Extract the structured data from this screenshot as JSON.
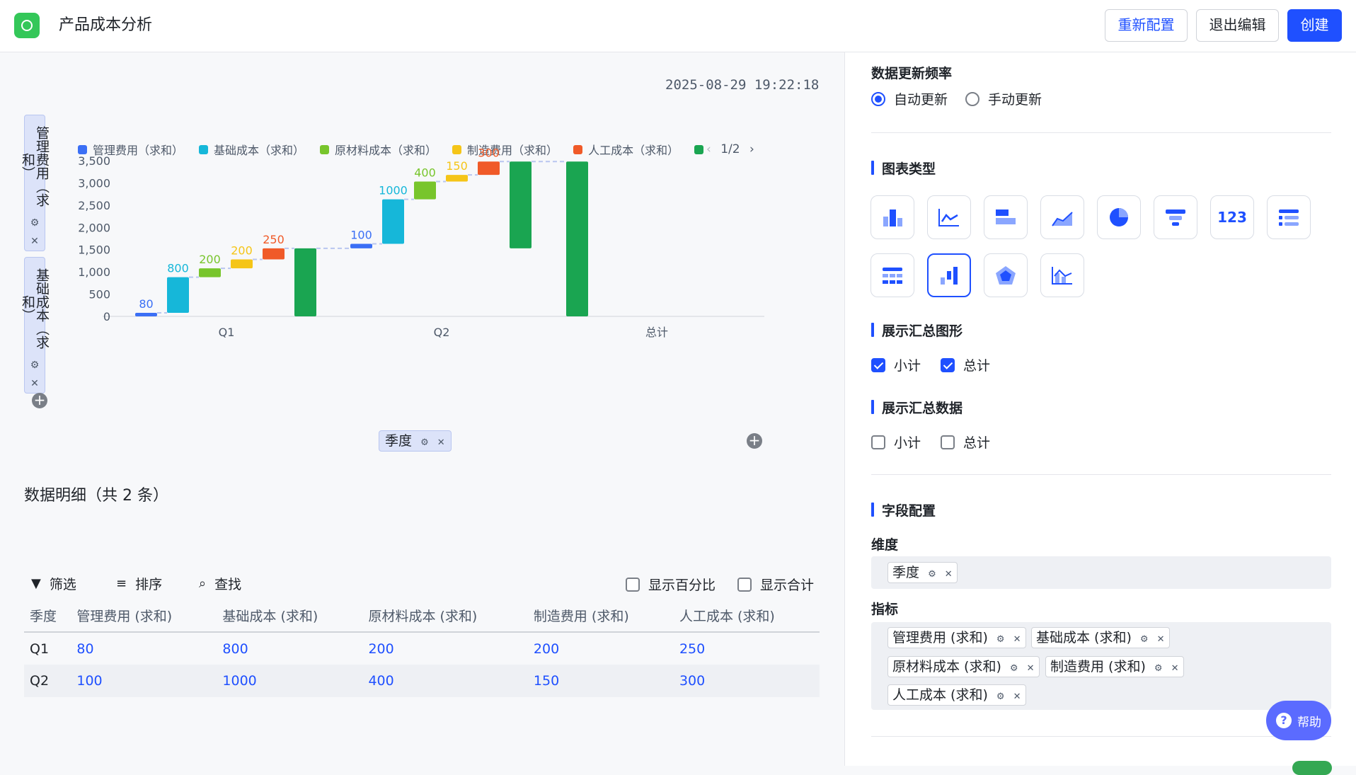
{
  "header": {
    "title": "产品成本分析",
    "reconfigure_label": "重新配置",
    "exit_label": "退出编辑",
    "create_label": "创建"
  },
  "timestamp": "2025-08-29 19:22:18",
  "axis_tags": {
    "measure1": "管理费用（求和）",
    "measure2": "基础成本（求和）"
  },
  "legend": {
    "items": [
      {
        "label": "管理费用（求和）",
        "color": "#3b6ff5"
      },
      {
        "label": "基础成本（求和）",
        "color": "#16b7d9"
      },
      {
        "label": "原材料成本（求和）",
        "color": "#78c52c"
      },
      {
        "label": "制造费用（求和）",
        "color": "#f5c518"
      },
      {
        "label": "人工成本（求和）",
        "color": "#f05a28"
      },
      {
        "label": "",
        "color": "#1aa551"
      }
    ],
    "page": "1/2"
  },
  "chart_data": {
    "type": "bar",
    "subtype": "waterfall",
    "categories": [
      "Q1",
      "Q2",
      "总计"
    ],
    "yticks": [
      "0",
      "500",
      "1,000",
      "1,500",
      "2,000",
      "2,500",
      "3,000",
      "3,500"
    ],
    "ylim": [
      0,
      3500
    ],
    "series": [
      {
        "name": "管理费用（求和）",
        "values": [
          80,
          100
        ],
        "color": "#3b6ff5"
      },
      {
        "name": "基础成本（求和）",
        "values": [
          800,
          1000
        ],
        "color": "#16b7d9"
      },
      {
        "name": "原材料成本（求和）",
        "values": [
          200,
          400
        ],
        "color": "#78c52c"
      },
      {
        "name": "制造费用（求和）",
        "values": [
          200,
          150
        ],
        "color": "#f5c518"
      },
      {
        "name": "人工成本（求和）",
        "values": [
          250,
          300
        ],
        "color": "#f05a28"
      }
    ],
    "subtotals": [
      {
        "label": "Q1",
        "from": 0,
        "to": 1530
      },
      {
        "label": "Q2",
        "from": 1530,
        "to": 3480
      }
    ],
    "total": {
      "from": 0,
      "to": 3480
    },
    "data_labels": [
      "80",
      "800",
      "200",
      "200",
      "250",
      "100",
      "1000",
      "400",
      "150",
      "300"
    ]
  },
  "dimension_chip": "季度",
  "detail": {
    "title": "数据明细（共 2 条）",
    "filter_label": "筛选",
    "sort_label": "排序",
    "find_label": "查找",
    "show_percent_label": "显示百分比",
    "show_total_label": "显示合计",
    "columns": [
      "季度",
      "管理费用 (求和)",
      "基础成本 (求和)",
      "原材料成本 (求和)",
      "制造费用 (求和)",
      "人工成本 (求和)"
    ],
    "rows": [
      [
        "Q1",
        "80",
        "800",
        "200",
        "200",
        "250"
      ],
      [
        "Q2",
        "100",
        "1000",
        "400",
        "150",
        "300"
      ]
    ]
  },
  "panel": {
    "refresh_title": "数据更新频率",
    "auto_label": "自动更新",
    "manual_label": "手动更新",
    "chart_type_title": "图表类型",
    "chart_type_icons": [
      "bar-chart-icon",
      "line-chart-icon",
      "horizontal-bar-icon",
      "area-chart-icon",
      "pie-chart-icon",
      "funnel-icon",
      "number-card-icon",
      "list-icon",
      "table-icon",
      "waterfall-icon",
      "radar-icon",
      "combo-chart-icon"
    ],
    "show_summary_shape_title": "展示汇总图形",
    "subtotal_label": "小计",
    "total_label": "总计",
    "show_summary_data_title": "展示汇总数据",
    "field_config_title": "字段配置",
    "dimension_title": "维度",
    "dimension_chip": "季度",
    "measure_title": "指标",
    "measure_chips": [
      "管理费用 (求和)",
      "基础成本 (求和)",
      "原材料成本 (求和)",
      "制造费用 (求和)",
      "人工成本 (求和)"
    ],
    "help_label": "帮助"
  }
}
